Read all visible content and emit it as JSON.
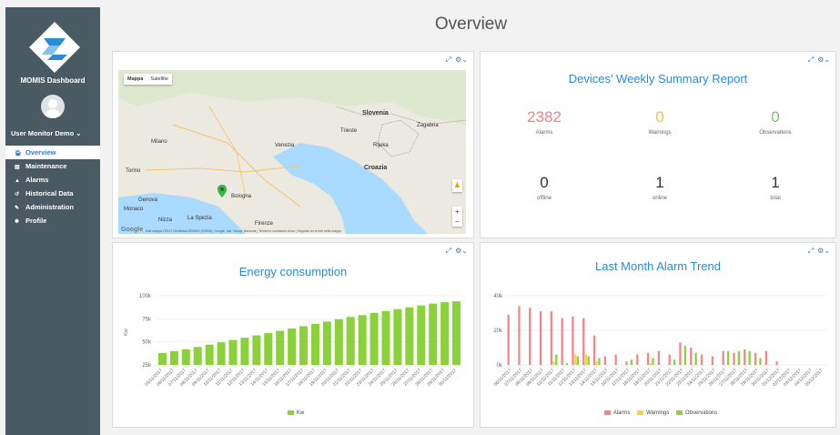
{
  "app": {
    "name": "MOMIS Dashboard",
    "user": "User Monitor Demo"
  },
  "page_title": "Overview",
  "nav": [
    {
      "label": "Overview",
      "icon": "home-icon"
    },
    {
      "label": "Maintenance",
      "icon": "document-icon"
    },
    {
      "label": "Alarms",
      "icon": "warning-icon"
    },
    {
      "label": "Historical Data",
      "icon": "history-icon"
    },
    {
      "label": "Administration",
      "icon": "wrench-icon"
    },
    {
      "label": "Profile",
      "icon": "gear-icon"
    }
  ],
  "map": {
    "type_buttons": [
      "Mappa",
      "Satellite"
    ],
    "labels": [
      "Slovenia",
      "Zagabria",
      "Milano",
      "Venezia",
      "Trieste",
      "Torino",
      "Bologna",
      "Genova",
      "Croazia",
      "Firenze",
      "Monaco",
      "La Spezia",
      "Rijeka",
      "Nizza"
    ],
    "attribution": "Dati mappa ©2017 GeoBasis-DE/BKG (©2009), Google, Inst. Geogr. Nacional   |   Termini e condizioni d'uso   |   Segnala un errore nella mappa",
    "google": "Google"
  },
  "summary": {
    "title": "Devices' Weekly Summary Report",
    "stats": [
      {
        "value": "2382",
        "label": "Alarms",
        "color": "#f08080"
      },
      {
        "value": "0",
        "label": "Warnings",
        "color": "#e8c84a"
      },
      {
        "value": "0",
        "label": "Observations",
        "color": "#7cc36a"
      },
      {
        "value": "0",
        "label": "offline",
        "color": "#444444"
      },
      {
        "value": "1",
        "label": "online",
        "color": "#444444"
      },
      {
        "value": "1",
        "label": "total",
        "color": "#444444"
      }
    ]
  },
  "energy": {
    "title": "Energy consumption",
    "legend": "Kw",
    "chart_data": {
      "type": "bar",
      "ylabel": "Kw",
      "ylim": [
        25000,
        100000
      ],
      "yticks": [
        "25k",
        "50k",
        "75k",
        "100k"
      ],
      "color": "#8bd13b",
      "categories": [
        "05/11/2017",
        "06/11/2017",
        "07/11/2017",
        "08/11/2017",
        "09/11/2017",
        "10/11/2017",
        "11/11/2017",
        "12/11/2017",
        "13/11/2017",
        "14/11/2017",
        "15/11/2017",
        "16/11/2017",
        "17/11/2017",
        "18/11/2017",
        "19/11/2017",
        "20/11/2017",
        "21/11/2017",
        "22/11/2017",
        "23/11/2017",
        "24/11/2017",
        "25/11/2017",
        "26/11/2017",
        "27/11/2017",
        "28/11/2017",
        "29/11/2017",
        "30/11/2017"
      ],
      "values": [
        38000,
        40000,
        42000,
        44500,
        47000,
        49500,
        52000,
        54500,
        57000,
        59500,
        62000,
        64500,
        67000,
        69500,
        72000,
        74500,
        77000,
        79000,
        81500,
        83500,
        85500,
        87500,
        89500,
        91500,
        93000,
        94000
      ]
    }
  },
  "alarms": {
    "title": "Last Month Alarm Trend",
    "chart_data": {
      "type": "bar",
      "ylim": [
        0,
        40000
      ],
      "yticks": [
        "0k",
        "20k",
        "40k"
      ],
      "categories": [
        "06/11/2017",
        "07/11/2017",
        "08/11/2017",
        "09/11/2017",
        "10/11/2017",
        "11/11/2017",
        "12/11/2017",
        "13/11/2017",
        "14/11/2017",
        "15/11/2017",
        "16/11/2017",
        "17/11/2017",
        "18/11/2017",
        "19/11/2017",
        "20/11/2017",
        "21/11/2017",
        "22/11/2017",
        "23/11/2017",
        "24/11/2017",
        "25/11/2017",
        "26/11/2017",
        "27/11/2017",
        "28/11/2017",
        "29/11/2017",
        "30/11/2017",
        "01/12/2017",
        "02/12/2017",
        "03/12/2017",
        "04/12/2017",
        "05/12/2017"
      ],
      "series": [
        {
          "name": "Alarms",
          "color": "#f4858a",
          "values": [
            29000,
            34000,
            33000,
            31000,
            31000,
            27000,
            28000,
            27000,
            17000,
            5000,
            6000,
            2000,
            6000,
            7000,
            8000,
            6000,
            13000,
            10000,
            6000,
            5000,
            8000,
            7000,
            9000,
            7000,
            8000,
            2000,
            0,
            0,
            0,
            0
          ]
        },
        {
          "name": "Warnings",
          "color": "#f5d547",
          "values": [
            0,
            0,
            0,
            0,
            2000,
            0,
            6000,
            6000,
            2000,
            0,
            0,
            0,
            0,
            1000,
            0,
            0,
            0,
            0,
            0,
            0,
            0,
            0,
            0,
            0,
            0,
            0,
            0,
            0,
            0,
            0
          ]
        },
        {
          "name": "Observations",
          "color": "#8bd13b",
          "values": [
            0,
            0,
            0,
            0,
            6000,
            1000,
            5000,
            5000,
            4000,
            0,
            0,
            3000,
            0,
            4000,
            0,
            3000,
            11000,
            7000,
            0,
            0,
            8000,
            8000,
            8000,
            4000,
            0,
            0,
            0,
            0,
            0,
            0
          ]
        }
      ]
    }
  }
}
